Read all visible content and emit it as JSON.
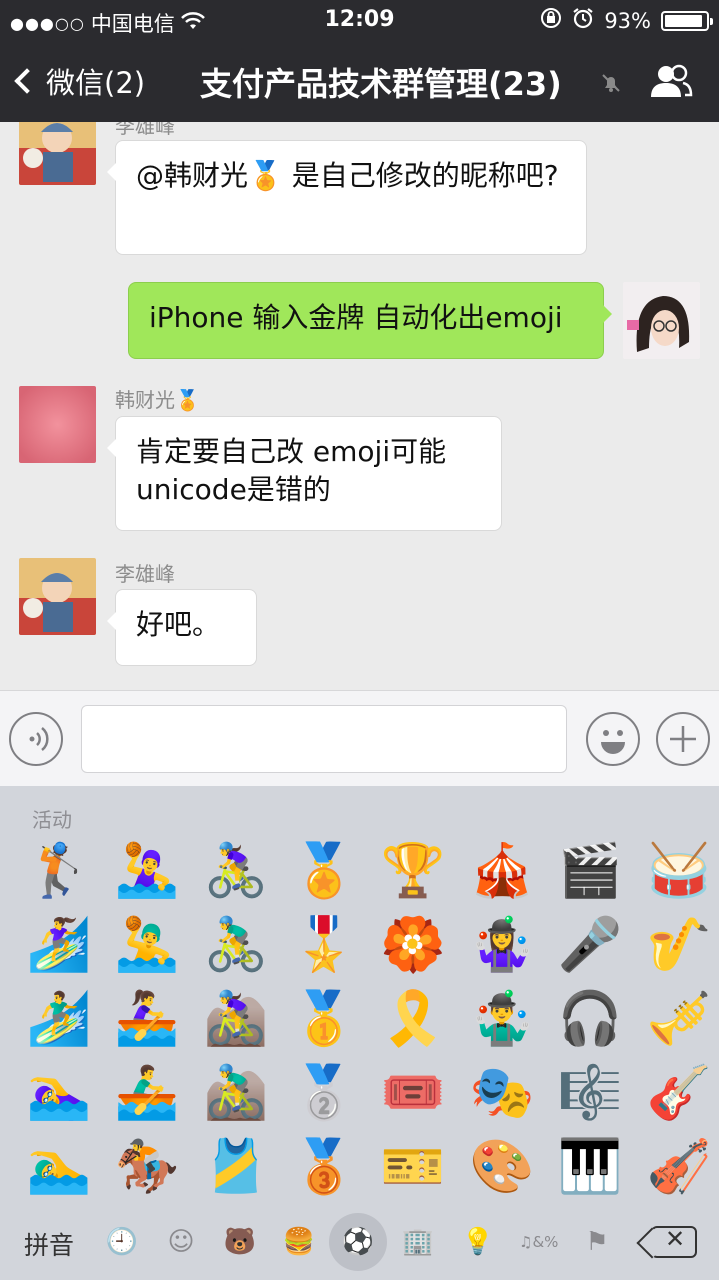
{
  "status": {
    "carrier": "中国电信",
    "time": "12:09",
    "battery": "93%",
    "battery_level": 0.93
  },
  "nav": {
    "back_label": "微信(2)",
    "title": "支付产品技术群管理(23)"
  },
  "messages": [
    {
      "sender": "李雄峰",
      "text": "@韩财光🏅 是自己修改的昵称吧?"
    },
    {
      "sender": "",
      "text": "iPhone 输入金牌 自动化出emoji"
    },
    {
      "sender": "韩财光🏅",
      "text": "肯定要自己改 emoji可能unicode是错的"
    },
    {
      "sender": "李雄峰",
      "text": "好吧。"
    }
  ],
  "keyboard": {
    "category_label": "活动",
    "emoji_rows": [
      [
        "🏌️",
        "🤽‍♀️",
        "🚴‍♀️",
        "🏅",
        "🏆",
        "🎪",
        "🎬",
        "🥁"
      ],
      [
        "🏄‍♀️",
        "🤽‍♂️",
        "🚴‍♂️",
        "🎖️",
        "🏵️",
        "🤹‍♀️",
        "🎤",
        "🎷"
      ],
      [
        "🏄‍♂️",
        "🚣‍♀️",
        "🚵‍♀️",
        "🥇",
        "🎗️",
        "🤹‍♂️",
        "🎧",
        "🎺"
      ],
      [
        "🏊‍♀️",
        "🚣‍♂️",
        "🚵‍♂️",
        "🥈",
        "🎟️",
        "🎭",
        "🎼",
        "🎸"
      ],
      [
        "🏊‍♂️",
        "🏇",
        "🎽",
        "🥉",
        "🎫",
        "🎨",
        "🎹",
        "🎻"
      ]
    ],
    "pinyin_label": "拼音",
    "tabs": [
      "🕘",
      "☺",
      "🐻",
      "🍔",
      "⚽",
      "🏢",
      "💡",
      "♫&%",
      "⚑"
    ],
    "delete_label": "✕"
  }
}
